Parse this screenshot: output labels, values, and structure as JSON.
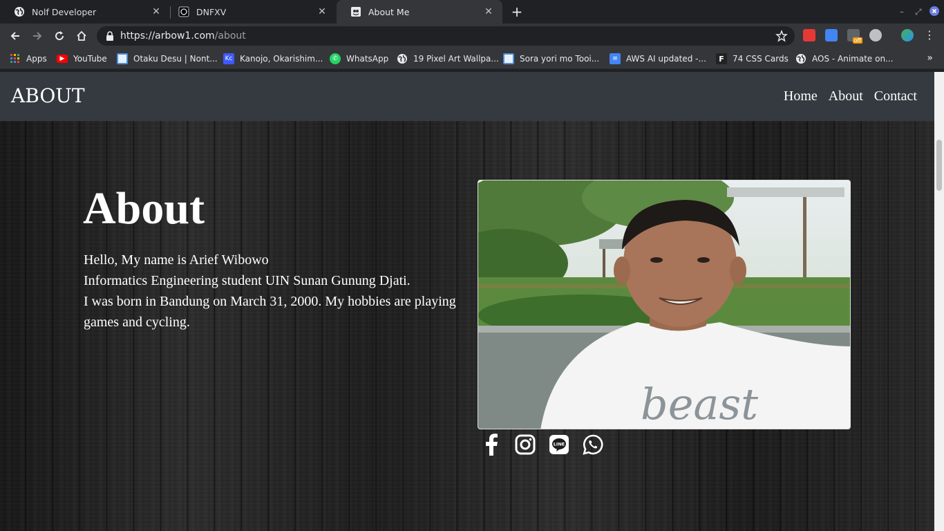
{
  "browser": {
    "tabs": [
      {
        "title": "Nolf Developer",
        "icon": "globe-icon",
        "active": false
      },
      {
        "title": "DNFXV",
        "icon": "dnfxv-icon",
        "active": false
      },
      {
        "title": "About Me",
        "icon": "page-icon",
        "active": true
      }
    ],
    "url": {
      "host": "https://arbow1.com",
      "path": "/about"
    },
    "bookmarks": [
      {
        "label": "Apps",
        "icon": "apps-grid-icon",
        "color": "#ea4335"
      },
      {
        "label": "YouTube",
        "icon": "youtube-icon",
        "color": "#ff0000"
      },
      {
        "label": "Otaku Desu | Nont...",
        "icon": "otaku-icon",
        "color": "#4a90d9"
      },
      {
        "label": "Kanojo, Okarishim...",
        "icon": "kc-icon",
        "color": "#3d5afe"
      },
      {
        "label": "WhatsApp",
        "icon": "whatsapp-icon",
        "color": "#25d366"
      },
      {
        "label": "19 Pixel Art Wallpa...",
        "icon": "globe-icon",
        "color": "#9aa0a6"
      },
      {
        "label": "Sora yori mo Tooi...",
        "icon": "sora-icon",
        "color": "#4a90d9"
      },
      {
        "label": "AWS AI updated -...",
        "icon": "docs-icon",
        "color": "#4285f4"
      },
      {
        "label": "74 CSS Cards",
        "icon": "f-icon",
        "color": "#222222"
      },
      {
        "label": "AOS - Animate on...",
        "icon": "globe-icon",
        "color": "#9aa0a6"
      }
    ],
    "bookmark_app_letter": "Kc",
    "f_letter": "F"
  },
  "site": {
    "brand": "ABOUT",
    "nav": [
      "Home",
      "About",
      "Contact"
    ],
    "heading": "About",
    "lines": [
      "Hello, My name is Arief Wibowo",
      "Informatics Engineering student UIN Sunan Gunung Djati.",
      "I was born in Bandung on March 31, 2000. My hobbies are playing games and cycling."
    ],
    "shirt_text": "beast",
    "socials": [
      "facebook-icon",
      "instagram-icon",
      "line-icon",
      "whatsapp-icon"
    ],
    "line_icon_text": "LINE"
  }
}
